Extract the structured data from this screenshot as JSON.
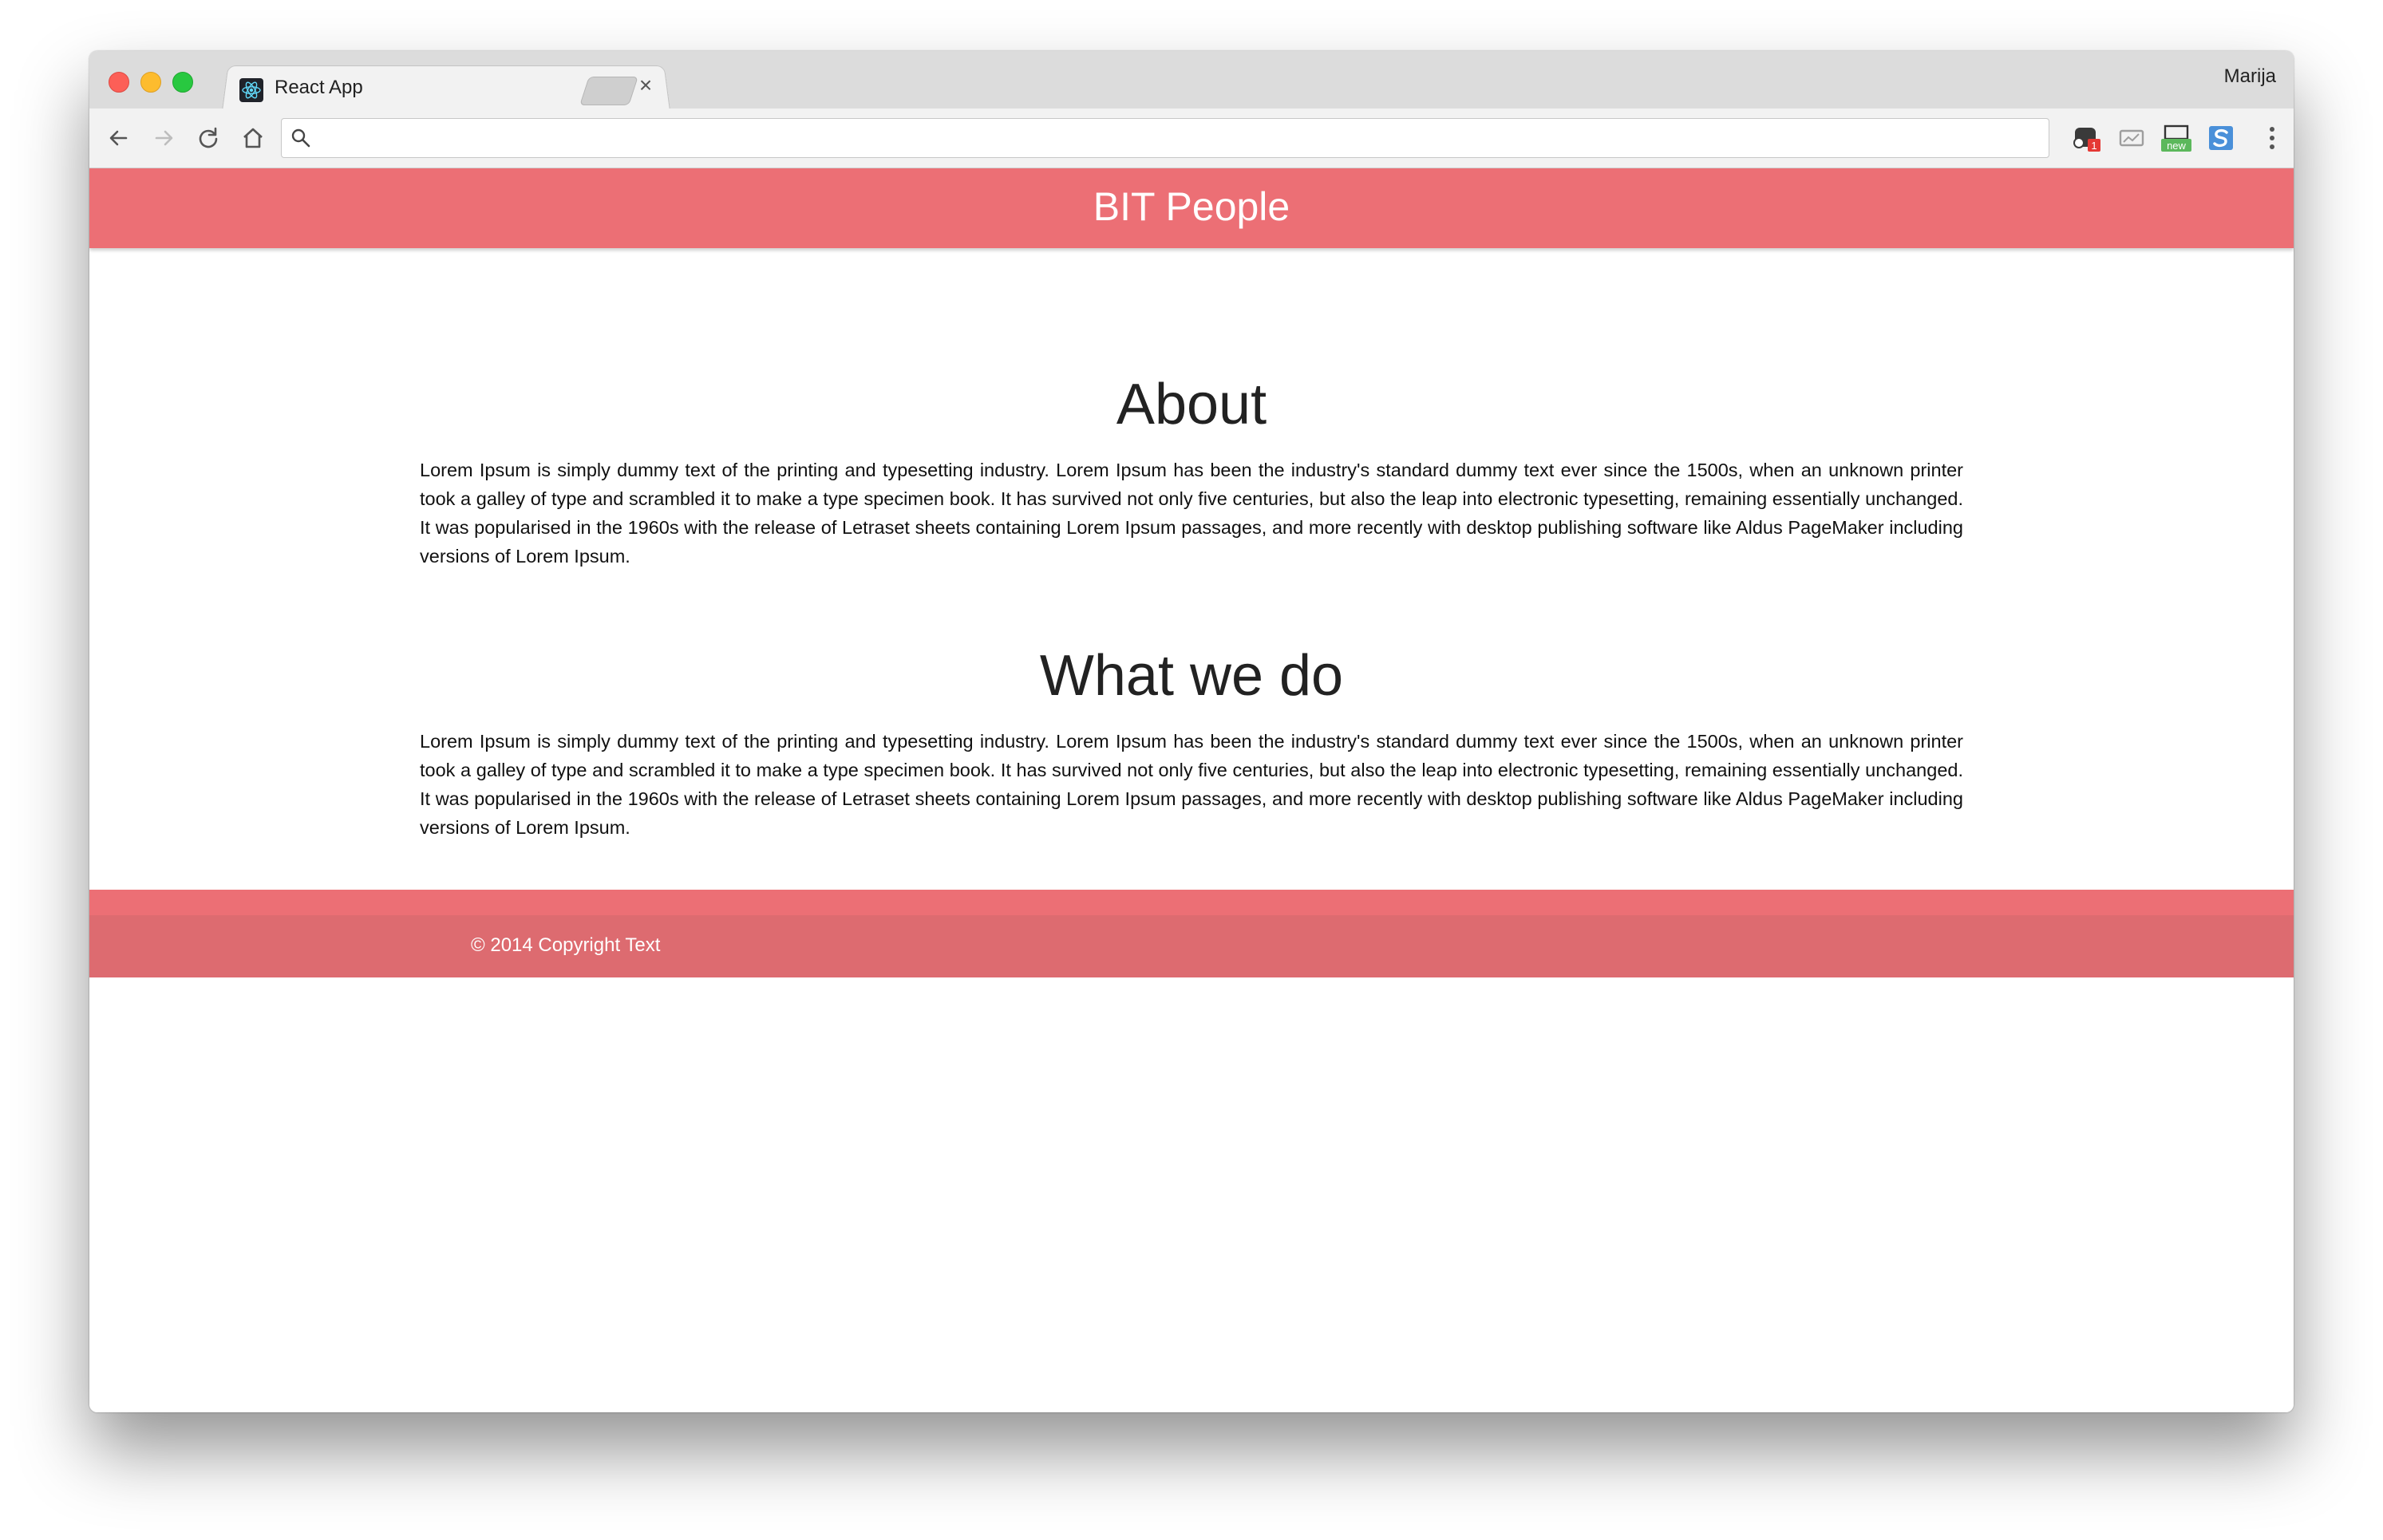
{
  "browser": {
    "tab_title": "React App",
    "tab_close": "×",
    "profile_name": "Marija",
    "address_value": "",
    "extension_badge": "1",
    "extension_new_label": "new"
  },
  "site": {
    "title": "BIT People",
    "header_color": "#ec6f75",
    "footer_color": "#dd6b70"
  },
  "sections": [
    {
      "heading": "About",
      "body": "Lorem Ipsum is simply dummy text of the printing and typesetting industry. Lorem Ipsum has been the industry's standard dummy text ever since the 1500s, when an unknown printer took a galley of type and scrambled it to make a type specimen book. It has survived not only five centuries, but also the leap into electronic typesetting, remaining essentially unchanged. It was popularised in the 1960s with the release of Letraset sheets containing Lorem Ipsum passages, and more recently with desktop publishing software like Aldus PageMaker including versions of Lorem Ipsum."
    },
    {
      "heading": "What we do",
      "body": "Lorem Ipsum is simply dummy text of the printing and typesetting industry. Lorem Ipsum has been the industry's standard dummy text ever since the 1500s, when an unknown printer took a galley of type and scrambled it to make a type specimen book. It has survived not only five centuries, but also the leap into electronic typesetting, remaining essentially unchanged. It was popularised in the 1960s with the release of Letraset sheets containing Lorem Ipsum passages, and more recently with desktop publishing software like Aldus PageMaker including versions of Lorem Ipsum."
    }
  ],
  "footer": {
    "copyright": "© 2014 Copyright Text"
  },
  "icons": [
    "close-window-icon",
    "minimize-window-icon",
    "zoom-window-icon",
    "react-logo-icon",
    "back-arrow-icon",
    "forward-arrow-icon",
    "reload-icon",
    "home-icon",
    "search-icon",
    "extension-icon",
    "more-menu-icon"
  ]
}
